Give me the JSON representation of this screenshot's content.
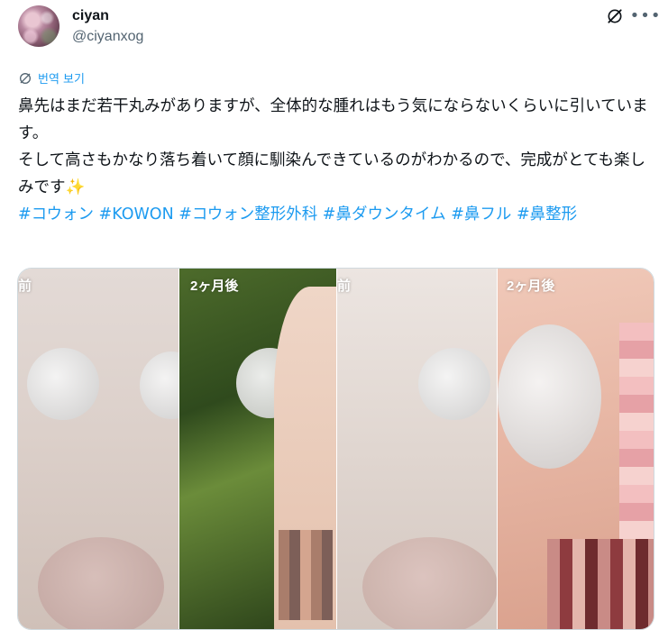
{
  "author": {
    "name": "ciyan",
    "handle": "@ciyanxog"
  },
  "translate_label": "번역 보기",
  "body": {
    "line1": "鼻先はまだ若干丸みがありますが、全体的な腫れはもう気にならないくらいに引いています。",
    "line2": "そして高さもかなり落ち着いて顔に馴染んできているのがわかるので、完成がとても楽しみです✨"
  },
  "hashtags": [
    "#コウォン",
    "#KOWON",
    "#コウォン整形外科",
    "#鼻ダウンタイム",
    "#鼻フル",
    "#鼻整形"
  ],
  "media": {
    "left_label_fragment": "前",
    "after_label_1": "2ヶ月後",
    "mid_label_fragment": "前",
    "after_label_2": "2ヶ月後"
  },
  "icons": {
    "grok": "grok-icon",
    "more": "more-icon",
    "translate": "globe-icon"
  },
  "colors": {
    "accent": "#1d9bf0",
    "text": "#0f1419",
    "muted": "#536471"
  }
}
